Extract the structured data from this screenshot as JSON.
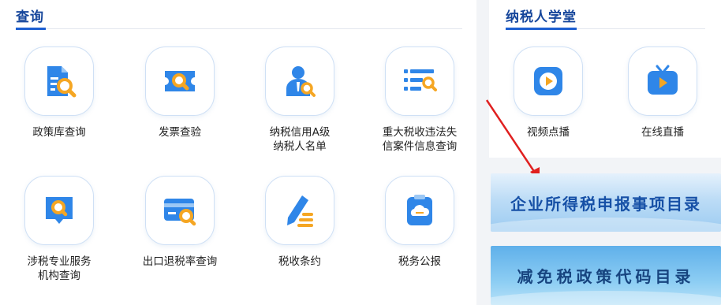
{
  "query": {
    "title": "查询",
    "items": [
      {
        "label": "政策库查询",
        "icon": "policy-search-icon"
      },
      {
        "label": "发票查验",
        "icon": "invoice-check-icon"
      },
      {
        "label": "纳税信用A级\n纳税人名单",
        "icon": "credit-rating-icon"
      },
      {
        "label": "重大税收违法失\n信案件信息查询",
        "icon": "violation-list-icon"
      },
      {
        "label": "涉税专业服务\n机构查询",
        "icon": "agency-search-icon"
      },
      {
        "label": "出口退税率查询",
        "icon": "card-search-icon"
      },
      {
        "label": "税收条约",
        "icon": "treaty-pen-icon"
      },
      {
        "label": "税务公报",
        "icon": "bulletin-cloud-icon"
      }
    ]
  },
  "school": {
    "title": "纳税人学堂",
    "items": [
      {
        "label": "视频点播",
        "icon": "video-play-icon"
      },
      {
        "label": "在线直播",
        "icon": "live-tv-icon"
      }
    ]
  },
  "banners": {
    "income_tax": "企业所得税申报事项目录",
    "tax_reduction": "减免税政策代码目录"
  },
  "colors": {
    "accent": "#1d5fd1",
    "title": "#16469b",
    "icon_blue": "#2f86e8",
    "icon_orange": "#f5a623",
    "arrow": "#e02020"
  }
}
